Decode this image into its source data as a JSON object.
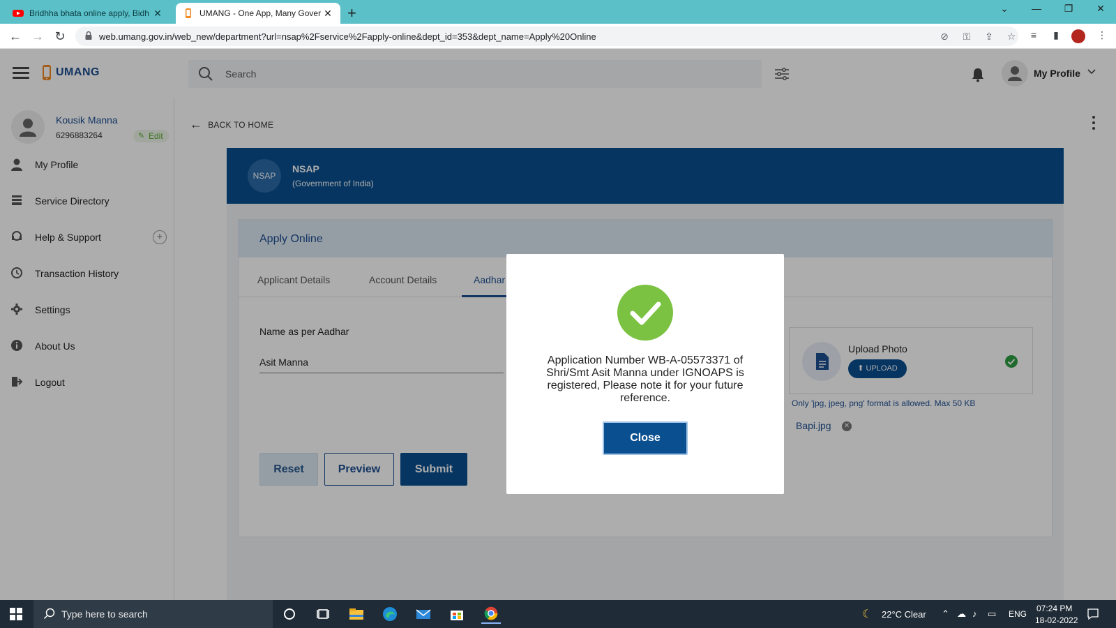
{
  "browser": {
    "tabs": [
      {
        "title": "Bridhha bhata online apply, Bidh",
        "close": "✕"
      },
      {
        "title": "UMANG - One App, Many Gover",
        "close": "✕"
      }
    ],
    "new_tab": "+",
    "url": "web.umang.gov.in/web_new/department?url=nsap%2Fservice%2Fapply-online&dept_id=353&dept_name=Apply%20Online"
  },
  "header": {
    "logo_text": "UMANG",
    "search_placeholder": "Search",
    "profile_label": "My Profile"
  },
  "sidebar": {
    "user_name": "Kousik Manna",
    "user_phone": "6296883264",
    "edit_label": "Edit",
    "items": [
      {
        "label": "My Profile",
        "icon": "user-icon"
      },
      {
        "label": "Service Directory",
        "icon": "directory-icon"
      },
      {
        "label": "Help & Support",
        "icon": "support-icon"
      },
      {
        "label": "Transaction History",
        "icon": "history-icon"
      },
      {
        "label": "Settings",
        "icon": "gear-icon"
      },
      {
        "label": "About Us",
        "icon": "info-icon"
      },
      {
        "label": "Logout",
        "icon": "logout-icon"
      }
    ]
  },
  "main": {
    "back_label": "BACK TO HOME",
    "dept_badge": "NSAP",
    "dept_name": "NSAP",
    "dept_sub": "(Government of India)",
    "apply_title": "Apply Online",
    "tabs": [
      "Applicant Details",
      "Account Details",
      "Aadhar"
    ],
    "field_label": "Name as per Aadhar",
    "field_value": "Asit Manna",
    "buttons": {
      "reset": "Reset",
      "preview": "Preview",
      "submit": "Submit"
    },
    "upload_title": "Upload Photo",
    "upload_button": "UPLOAD",
    "upload_note": "Only 'jpg, jpeg, png' format is allowed. Max 50 KB",
    "file_name": "Bapi.jpg"
  },
  "modal": {
    "message": "Application Number WB-A-05573371 of Shri/Smt Asit Manna under IGNOAPS is registered, Please note it for your future reference.",
    "close_label": "Close"
  },
  "taskbar": {
    "search_placeholder": "Type here to search",
    "weather": "22°C  Clear",
    "lang": "ENG",
    "time": "07:24 PM",
    "date": "18-02-2022"
  },
  "colors": {
    "tabstrip": "#5bc0c8",
    "primary": "#0a4f8f",
    "success": "#7cc242",
    "taskbar": "#1f2b36"
  }
}
